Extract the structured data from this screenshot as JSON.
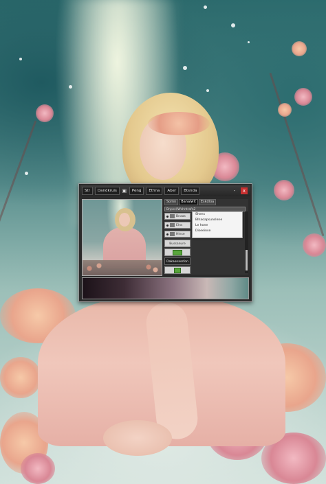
{
  "window": {
    "menu": [
      "Str",
      "Dandkruis",
      "Peng",
      "Ethna",
      "Aber",
      "Btsnda"
    ],
    "minimize_label": "-",
    "close_label": "x",
    "colors": {
      "frame": "#2b2b2b",
      "close": "#c73030",
      "accent_green": "#59a53c"
    }
  },
  "panel": {
    "tabs": [
      "Somn",
      "Banalwit",
      "Eskdloa"
    ],
    "active_tab": 1,
    "search_text": "Bnpssl/Wshntrafn2",
    "layers": [
      {
        "label": "Bnaas"
      },
      {
        "label": "Elns"
      },
      {
        "label": "Hlnse"
      }
    ],
    "dropdown_items": [
      "Shens",
      "Blhaoapsunslene",
      "Le hone",
      "Diseeinse"
    ],
    "buttons": [
      "Bussanure",
      "Dakaonassfon"
    ]
  }
}
